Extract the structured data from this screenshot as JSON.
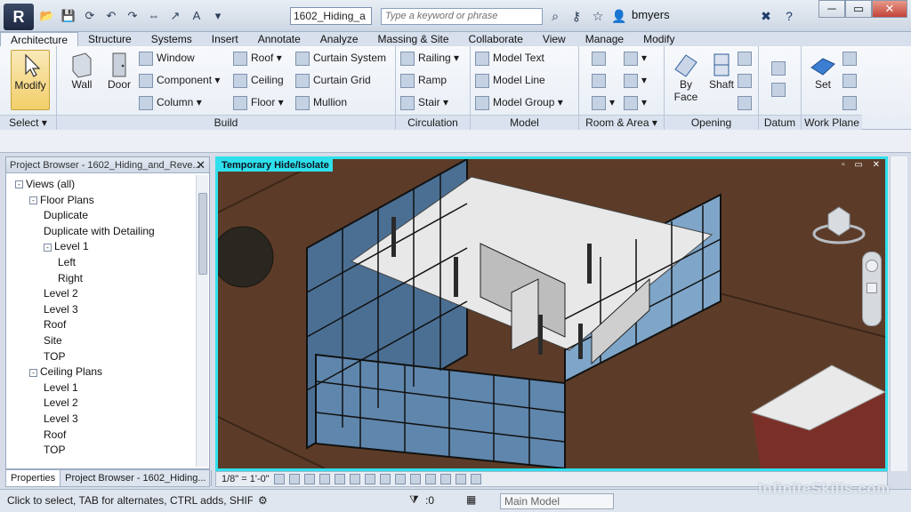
{
  "titlebar": {
    "document_title": "1602_Hiding_a",
    "search_placeholder": "Type a keyword or phrase",
    "user": "bmyers"
  },
  "tabs": [
    "Architecture",
    "Structure",
    "Systems",
    "Insert",
    "Annotate",
    "Analyze",
    "Massing & Site",
    "Collaborate",
    "View",
    "Manage",
    "Modify"
  ],
  "ribbon": {
    "select": {
      "title": "Select",
      "modify": "Modify"
    },
    "build": {
      "title": "Build",
      "wall": "Wall",
      "door": "Door",
      "window": "Window",
      "component": "Component",
      "column": "Column",
      "roof": "Roof",
      "ceiling": "Ceiling",
      "floor": "Floor",
      "curtain_system": "Curtain  System",
      "curtain_grid": "Curtain  Grid",
      "mullion": "Mullion"
    },
    "circulation": {
      "title": "Circulation",
      "railing": "Railing",
      "ramp": "Ramp",
      "stair": "Stair"
    },
    "model": {
      "title": "Model",
      "model_text": "Model  Text",
      "model_line": "Model  Line",
      "model_group": "Model  Group"
    },
    "room_area": {
      "title": "Room & Area"
    },
    "opening": {
      "title": "Opening",
      "by_face_1": "By",
      "by_face_2": "Face",
      "shaft": "Shaft"
    },
    "datum": {
      "title": "Datum"
    },
    "work_plane": {
      "title": "Work Plane",
      "set": "Set"
    }
  },
  "project_browser": {
    "title": "Project Browser - 1602_Hiding_and_Reve...",
    "items": [
      {
        "label": "Views (all)",
        "level": 0,
        "toggle": "-"
      },
      {
        "label": "Floor Plans",
        "level": 1,
        "toggle": "-"
      },
      {
        "label": "Duplicate",
        "level": 2,
        "toggle": ""
      },
      {
        "label": "Duplicate with Detailing",
        "level": 2,
        "toggle": ""
      },
      {
        "label": "Level 1",
        "level": 2,
        "toggle": "-"
      },
      {
        "label": "Left",
        "level": 3,
        "toggle": ""
      },
      {
        "label": "Right",
        "level": 3,
        "toggle": ""
      },
      {
        "label": "Level 2",
        "level": 2,
        "toggle": ""
      },
      {
        "label": "Level 3",
        "level": 2,
        "toggle": ""
      },
      {
        "label": "Roof",
        "level": 2,
        "toggle": ""
      },
      {
        "label": "Site",
        "level": 2,
        "toggle": ""
      },
      {
        "label": "TOP",
        "level": 2,
        "toggle": ""
      },
      {
        "label": "Ceiling Plans",
        "level": 1,
        "toggle": "-"
      },
      {
        "label": "Level 1",
        "level": 2,
        "toggle": ""
      },
      {
        "label": "Level 2",
        "level": 2,
        "toggle": ""
      },
      {
        "label": "Level 3",
        "level": 2,
        "toggle": ""
      },
      {
        "label": "Roof",
        "level": 2,
        "toggle": ""
      },
      {
        "label": "TOP",
        "level": 2,
        "toggle": ""
      }
    ]
  },
  "bottom_tabs": {
    "properties": "Properties",
    "browser": "Project Browser - 1602_Hiding..."
  },
  "view": {
    "label": "Temporary Hide/Isolate",
    "scale": "1/8\" = 1'-0\""
  },
  "status": {
    "hint": "Click to select, TAB for alternates, CTRL adds, SHIFT r",
    "count": ":0",
    "model": "Main Model"
  },
  "watermark": "InfiniteSkills.com"
}
